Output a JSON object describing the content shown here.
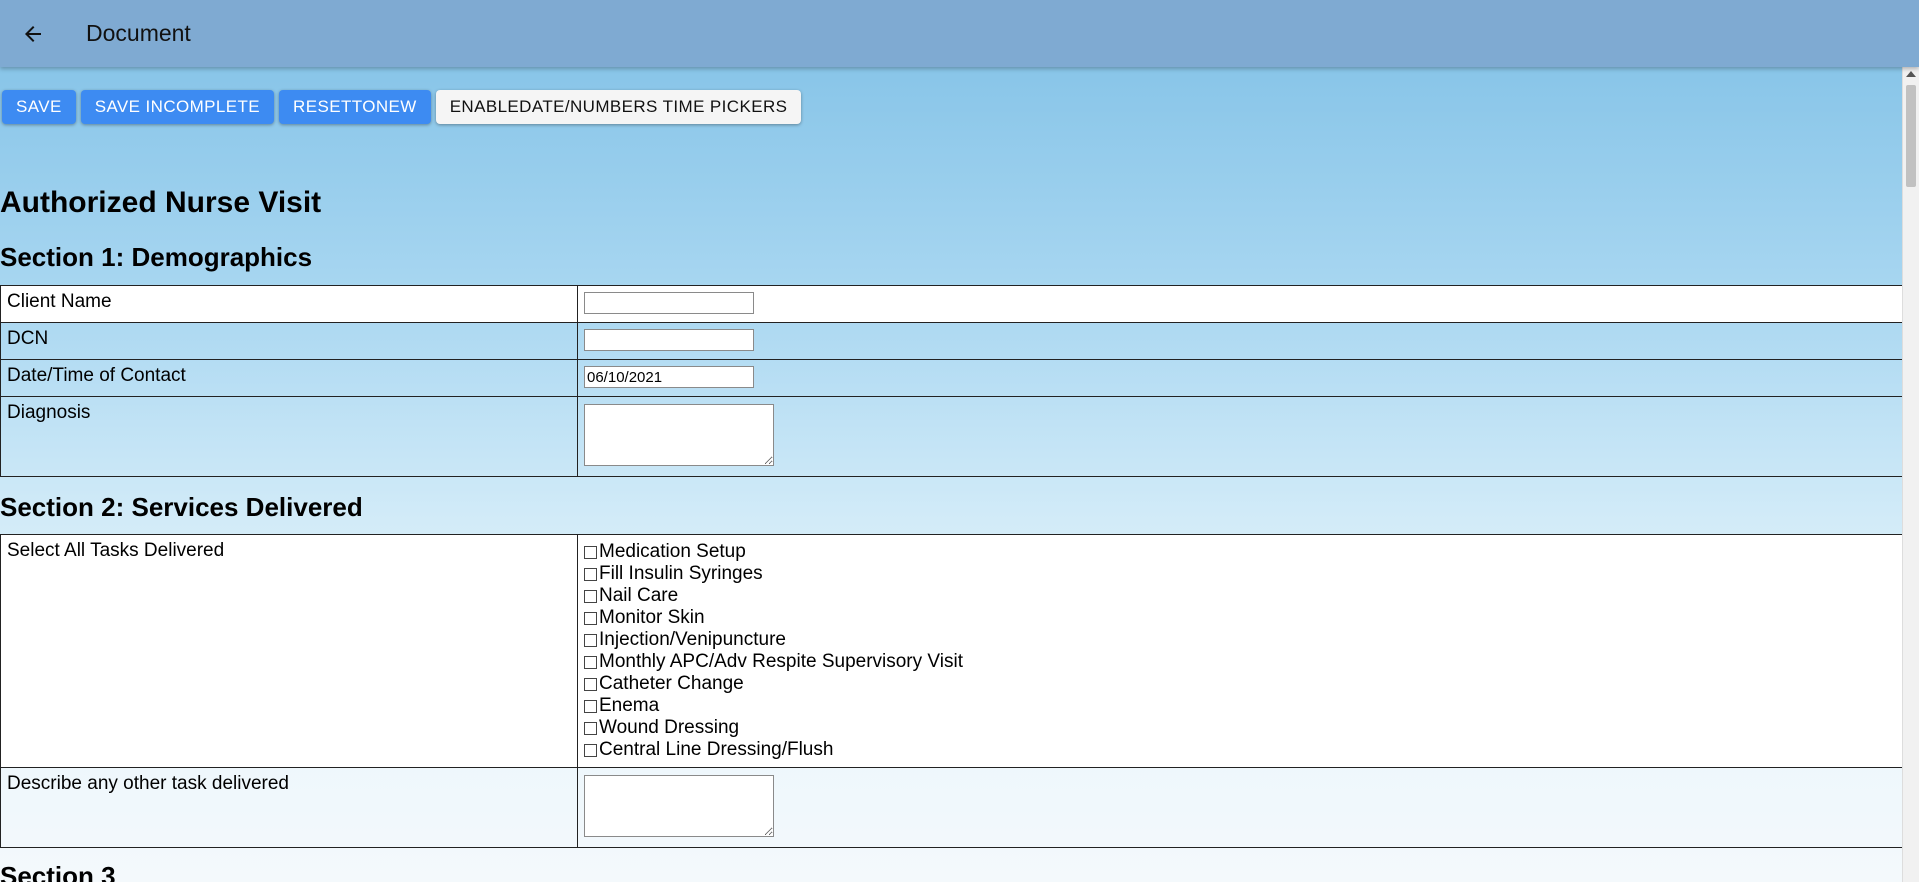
{
  "appbar": {
    "title": "Document"
  },
  "toolbar": {
    "save_label": "SAVE",
    "save_incomplete_label": "SAVE INCOMPLETE",
    "reset_label": "RESETTONEW",
    "enable_pickers_label": "ENABLEDATE/NUMBERS TIME PICKERS"
  },
  "form": {
    "title": "Authorized Nurse Visit",
    "section1": {
      "heading": "Section 1: Demographics",
      "client_name_label": "Client Name",
      "client_name_value": "",
      "dcn_label": "DCN",
      "dcn_value": "",
      "contact_label": "Date/Time of Contact",
      "contact_value": "06/10/2021",
      "diagnosis_label": "Diagnosis",
      "diagnosis_value": ""
    },
    "section2": {
      "heading": "Section 2: Services Delivered",
      "tasks_label": "Select All Tasks Delivered",
      "tasks": [
        "Medication Setup",
        "Fill Insulin Syringes",
        "Nail Care",
        "Monitor Skin",
        "Injection/Venipuncture",
        "Monthly APC/Adv Respite Supervisory Visit",
        "Catheter Change",
        "Enema",
        "Wound Dressing",
        "Central Line Dressing/Flush"
      ],
      "other_label": "Describe any other task delivered",
      "other_value": ""
    },
    "section3": {
      "heading": "Section 3"
    }
  }
}
